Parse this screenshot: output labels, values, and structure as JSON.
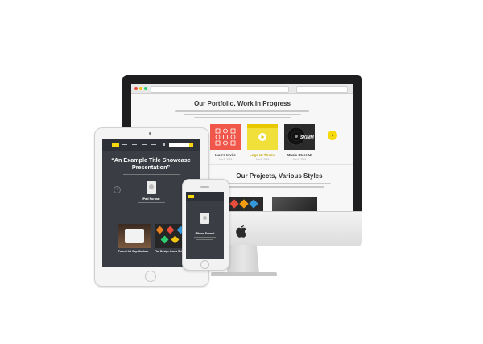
{
  "imac_site": {
    "portfolio_title": "Our Portfolio, Work In Progress",
    "projects_title": "Our Projects, Various Styles",
    "next_arrow": "›",
    "tiles": [
      {
        "label": "Icon's Invite",
        "date": "Apr 6, 2015",
        "color": "#f0564a",
        "label_color": "#333333"
      },
      {
        "label": "Logo UI Theme",
        "date": "Apr 6, 2015",
        "color": "#f2e03a",
        "label_color": "#c4a800"
      },
      {
        "label": "Music Store UI",
        "date": "Apr 6, 2015",
        "color": "#2b2b2b",
        "label_color": "#333333"
      }
    ],
    "vinyl_text": "SKIMM"
  },
  "ipad_site": {
    "hero_title_line1": "“An Example Title Showcase",
    "hero_title_line2": "Presentation”",
    "card_title": "iPad Format",
    "item1": "Paper Hot Cup Mockup",
    "item2": "Flat Design Icons Set"
  },
  "iphone_site": {
    "card_title": "iPhone Format"
  },
  "colors": {
    "accent": "#f5d90a",
    "dark_bg": "#3a3d44",
    "frame": "#1e1e20"
  }
}
